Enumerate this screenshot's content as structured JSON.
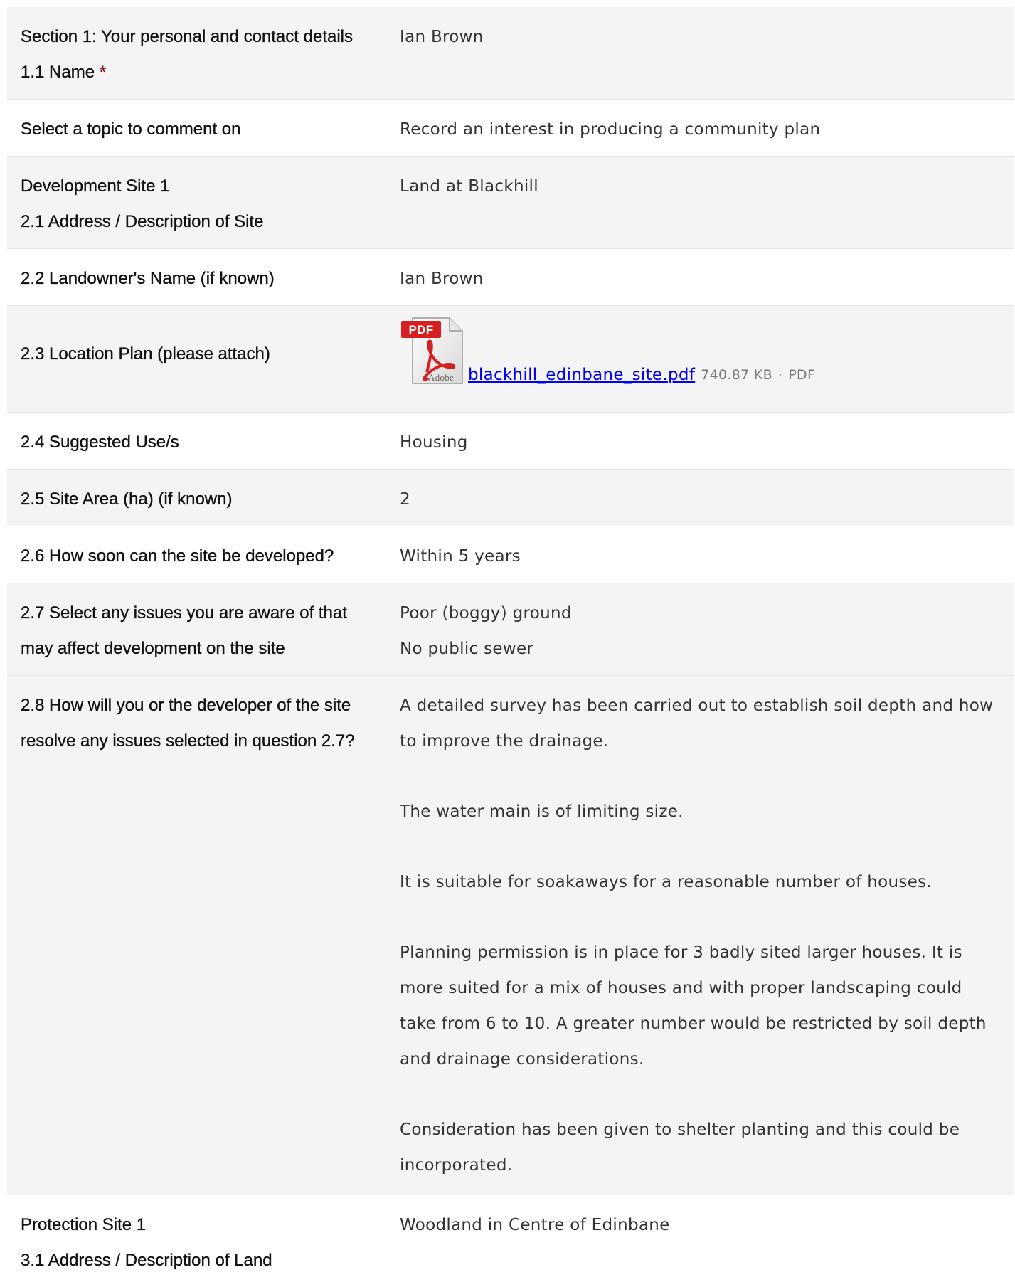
{
  "rows": [
    {
      "label_lines": [
        "Section 1: Your personal and contact details",
        "1.1 Name "
      ],
      "required_mark": "*",
      "values": [
        "Ian Brown"
      ]
    },
    {
      "label_lines": [
        "Select a topic to comment on"
      ],
      "values": [
        "Record an interest in producing a community plan"
      ]
    },
    {
      "label_lines": [
        "Development Site 1",
        "2.1 Address / Description of Site"
      ],
      "values": [
        "Land at Blackhill"
      ]
    },
    {
      "label_lines": [
        "2.2 Landowner's Name (if known)"
      ],
      "values": [
        "Ian Brown"
      ]
    },
    {
      "label_lines": [
        "2.3 Location Plan (please attach)"
      ],
      "attachment": {
        "icon": "pdf-file-icon",
        "icon_text_top": "PDF",
        "icon_text_bottom": "Adobe",
        "filename": "blackhill_edinbane_site.pdf",
        "size": "740.87 KB",
        "separator": "·",
        "type": "PDF"
      }
    },
    {
      "label_lines": [
        "2.4 Suggested Use/s"
      ],
      "values": [
        "Housing"
      ]
    },
    {
      "label_lines": [
        "2.5 Site Area (ha) (if known)"
      ],
      "values": [
        "2"
      ]
    },
    {
      "label_lines": [
        "2.6 How soon can the site be developed?"
      ],
      "values": [
        "Within 5 years"
      ]
    },
    {
      "label_lines": [
        "2.7 Select any issues you are aware of that",
        "may affect development on the site"
      ],
      "values": [
        "Poor (boggy) ground",
        "No public sewer"
      ]
    },
    {
      "label_lines": [
        "2.8 How will you or the developer of the site",
        "resolve any issues selected in question 2.7?"
      ],
      "paragraphs": [
        [
          "A detailed survey has been carried out to establish soil depth and how",
          "to improve the drainage."
        ],
        [
          "The water main is of limiting size."
        ],
        [
          "It is suitable for soakaways for a reasonable number of houses."
        ],
        [
          "Planning permission is in place for 3 badly sited larger houses. It is",
          "more suited for a mix of houses and with proper landscaping could",
          "take from 6 to 10. A greater number would be restricted by soil depth",
          "and drainage considerations."
        ],
        [
          "Consideration has been given to shelter planting and this could be",
          "incorporated."
        ]
      ]
    },
    {
      "label_lines": [
        "Protection Site 1",
        "3.1 Address / Description of Land"
      ],
      "values": [
        "Woodland in Centre of Edinbane"
      ]
    }
  ],
  "colors": {
    "shade": "#f4f4f4",
    "white": "#ffffff",
    "required": "#d40000",
    "link": "#0000ee"
  }
}
